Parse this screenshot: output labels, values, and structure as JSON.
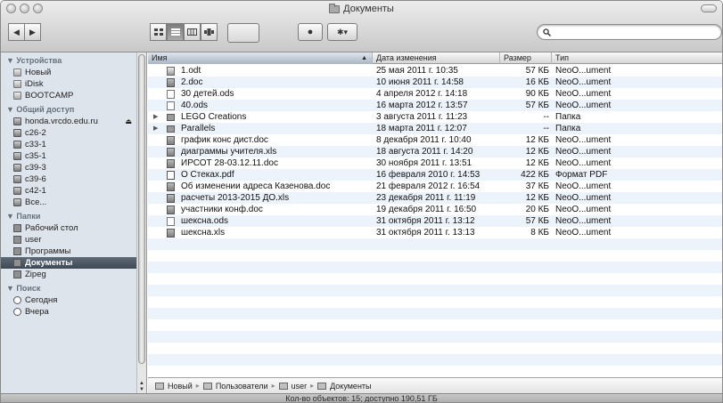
{
  "window": {
    "title": "Документы"
  },
  "toolbar": {
    "back_label": "◀",
    "forward_label": "▶",
    "quicklook_label": "●",
    "action_label": "✱▾",
    "search_placeholder": ""
  },
  "sidebar": {
    "sections": [
      {
        "title": "▼ Устройства",
        "items": [
          "Новый",
          "iDisk",
          "BOOTCAMP"
        ]
      },
      {
        "title": "▼ Общий доступ",
        "items": [
          "honda.vrcdo.edu.ru",
          "c26-2",
          "c33-1",
          "c35-1",
          "c39-3",
          "c39-6",
          "c42-1",
          "Все..."
        ]
      },
      {
        "title": "▼ Папки",
        "items": [
          "Рабочий стол",
          "user",
          "Программы",
          "Документы",
          "Zipeg"
        ]
      },
      {
        "title": "▼ Поиск",
        "items": [
          "Сегодня",
          "Вчера"
        ]
      }
    ],
    "eject_symbol": "⏏"
  },
  "columns": {
    "name": "Имя",
    "date": "Дата изменения",
    "size": "Размер",
    "type": "Тип"
  },
  "files": [
    {
      "name": "1.odt",
      "date": "25 мая 2011 г. 10:35",
      "size": "57 КБ",
      "type": "NeoO...ument",
      "icon": "odt-file-icon",
      "folder": false
    },
    {
      "name": "2.doc",
      "date": "10 июня 2011 г. 14:58",
      "size": "16 КБ",
      "type": "NeoO...ument",
      "icon": "doc-file-icon",
      "folder": false
    },
    {
      "name": "30 детей.ods",
      "date": "4 апреля 2012 г. 14:18",
      "size": "90 КБ",
      "type": "NeoO...ument",
      "icon": "blank-file-icon",
      "folder": false
    },
    {
      "name": "40.ods",
      "date": "16 марта 2012 г. 13:57",
      "size": "57 КБ",
      "type": "NeoO...ument",
      "icon": "blank-file-icon",
      "folder": false
    },
    {
      "name": "LEGO Creations",
      "date": "3 августа 2011 г. 11:23",
      "size": "--",
      "type": "Папка",
      "icon": "folder-icon",
      "folder": true
    },
    {
      "name": "Parallels",
      "date": "18 марта 2011 г. 12:07",
      "size": "--",
      "type": "Папка",
      "icon": "folder-icon",
      "folder": true
    },
    {
      "name": "график конс дист.doc",
      "date": "8 декабря 2011 г. 10:40",
      "size": "12 КБ",
      "type": "NeoO...ument",
      "icon": "doc-file-icon",
      "folder": false
    },
    {
      "name": "диаграммы учителя.xls",
      "date": "18 августа 2011 г. 14:20",
      "size": "12 КБ",
      "type": "NeoO...ument",
      "icon": "doc-file-icon",
      "folder": false
    },
    {
      "name": "ИРСОТ 28-03.12.11.doc",
      "date": "30 ноября 2011 г. 13:51",
      "size": "12 КБ",
      "type": "NeoO...ument",
      "icon": "doc-file-icon",
      "folder": false
    },
    {
      "name": "О Стеках.pdf",
      "date": "16 февраля 2010 г. 14:53",
      "size": "422 КБ",
      "type": "Формат PDF",
      "icon": "pdf-file-icon",
      "folder": false
    },
    {
      "name": "Об изменении адреса Казенова.doc",
      "date": "21 февраля 2012 г. 16:54",
      "size": "37 КБ",
      "type": "NeoO...ument",
      "icon": "doc-file-icon",
      "folder": false
    },
    {
      "name": "расчеты 2013-2015 ДО.xls",
      "date": "23 декабря 2011 г. 11:19",
      "size": "12 КБ",
      "type": "NeoO...ument",
      "icon": "doc-file-icon",
      "folder": false
    },
    {
      "name": "участники конф.doc",
      "date": "19 декабря 2011 г. 16:50",
      "size": "20 КБ",
      "type": "NeoO...ument",
      "icon": "doc-file-icon",
      "folder": false
    },
    {
      "name": "шексна.ods",
      "date": "31 октября 2011 г. 13:12",
      "size": "57 КБ",
      "type": "NeoO...ument",
      "icon": "blank-file-icon",
      "folder": false
    },
    {
      "name": "шексна.xls",
      "date": "31 октября 2011 г. 13:13",
      "size": "8 КБ",
      "type": "NeoO...ument",
      "icon": "doc-file-icon",
      "folder": false
    }
  ],
  "pathbar": [
    "Новый",
    "Пользователи",
    "user",
    "Документы"
  ],
  "status": "Кол-во объектов: 15; доступно 190,51 ГБ"
}
